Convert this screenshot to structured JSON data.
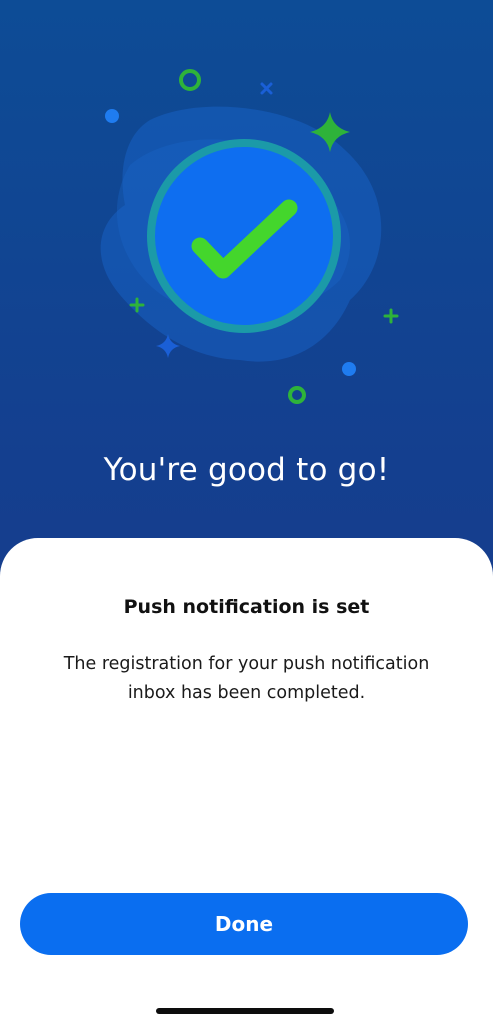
{
  "hero": {
    "title": "You're good to go!"
  },
  "sheet": {
    "title": "Push notification is set",
    "body": "The registration for your push notification inbox has been completed.",
    "done_label": "Done"
  },
  "colors": {
    "background_top": "#0d4c96",
    "background_bottom": "#1c3a88",
    "accent_button": "#0a6ef0",
    "check_green": "#44d62c",
    "ring_teal": "#1b9aa8"
  },
  "icons": {
    "main": "checkmark-circle-icon",
    "decorations": [
      "ring-icon",
      "x-icon",
      "dot-icon",
      "sparkle-icon",
      "plus-icon"
    ]
  }
}
